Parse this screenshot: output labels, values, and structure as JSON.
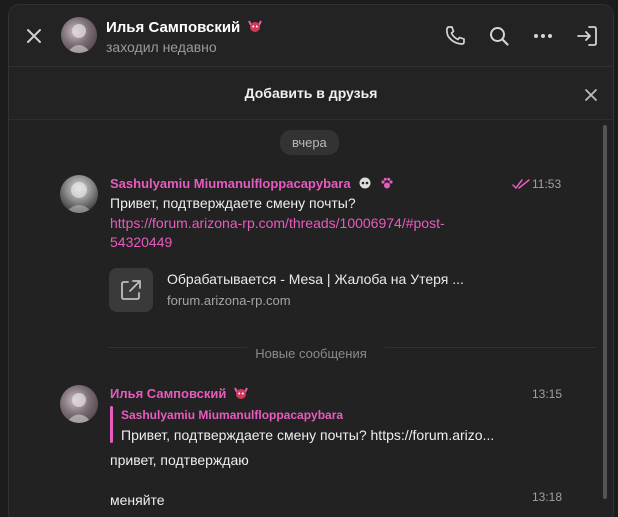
{
  "header": {
    "contact_name": "Илья Самповский",
    "status": "заходил недавно"
  },
  "banner": {
    "add_friend_label": "Добавить в друзья"
  },
  "chat": {
    "date_label": "вчера",
    "messages": [
      {
        "sender": "Sashulyamiu Miumanulfloppacapybara",
        "text": "Привет, подтверждаете смену почты?",
        "link_line1": "https://forum.arizona-rp.com/threads/10006974/#post-",
        "link_line2": "54320449",
        "time": "11:53",
        "preview": {
          "title": "Обрабатывается - Mesa | Жалоба на Утеря ...",
          "site": "forum.arizona-rp.com"
        }
      },
      {
        "sender": "Илья Самповский",
        "reply_to_sender": "Sashulyamiu Miumanulfloppacapybara",
        "reply_to_text": "Привет, подтверждаете смену почты? https://forum.arizo...",
        "text": "привет, подтверждаю",
        "time": "13:15"
      },
      {
        "text": "меняйте",
        "time": "13:18"
      }
    ],
    "new_messages_label": "Новые сообщения"
  },
  "colors": {
    "accent": "#e85bbf",
    "background": "#222222"
  }
}
